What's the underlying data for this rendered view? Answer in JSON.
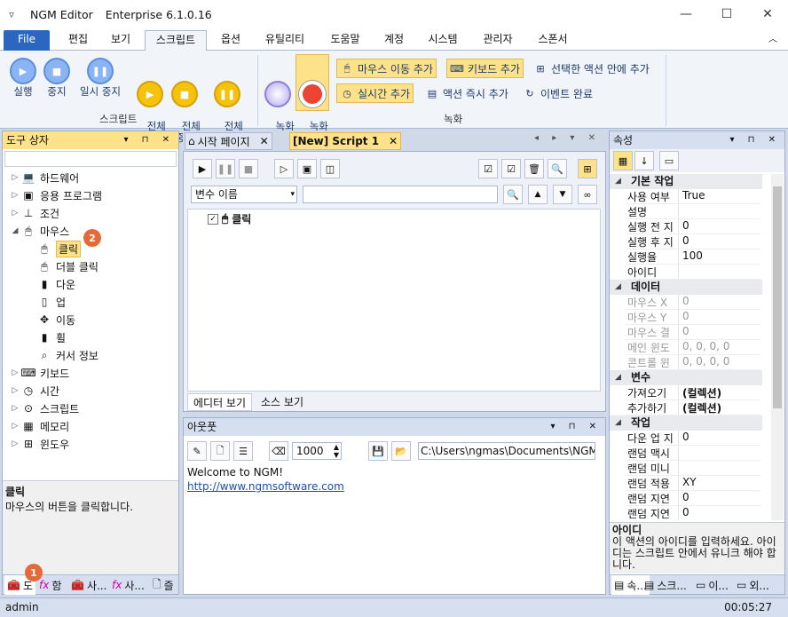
{
  "titlebar": {
    "quick_access": "▿",
    "app_name": "NGM Editor",
    "edition": "Enterprise 6.1.0.16"
  },
  "menu_tabs": [
    "File",
    "편집",
    "보기",
    "스크립트",
    "옵션",
    "유틸리티",
    "도움말",
    "계정",
    "시스템",
    "관리자",
    "스폰서"
  ],
  "ribbon": {
    "script_group": {
      "label": "스크립트",
      "buttons": [
        {
          "label": "실행",
          "icon": "play-icon"
        },
        {
          "label": "중지",
          "icon": "stop-icon"
        },
        {
          "label": "일시 중지",
          "icon": "pause-icon"
        },
        {
          "label": "전체\n실행",
          "icon": "play-all-icon"
        },
        {
          "label": "전체\n중지",
          "icon": "stop-all-icon"
        },
        {
          "label": "전체\n일시 중지",
          "icon": "pause-all-icon"
        }
      ]
    },
    "record_group": {
      "label": "녹화",
      "start": "녹화\n시작",
      "stop": "녹화\n중지",
      "mouse_move_add": "마우스 이동 추가",
      "keyboard_add": "키보드 추가",
      "in_selected": "선택한 액션 안에 추가",
      "realtime_add": "실시간 추가",
      "immediate_add": "액션 즉시 추가",
      "event_complete": "이벤트 완료"
    }
  },
  "toolbox": {
    "title": "도구 상자",
    "items": [
      {
        "label": "하드웨어",
        "icon": "laptop-icon",
        "level": 0,
        "exp": "▷"
      },
      {
        "label": "응용 프로그램",
        "icon": "app-window-icon",
        "level": 0,
        "exp": "▷"
      },
      {
        "label": "조건",
        "icon": "condition-icon",
        "level": 0,
        "exp": "▷"
      },
      {
        "label": "마우스",
        "icon": "mouse-icon",
        "level": 0,
        "exp": "◢"
      },
      {
        "label": "클릭",
        "icon": "mouse-click-icon",
        "level": 1,
        "exp": ""
      },
      {
        "label": "더블 클릭",
        "icon": "double-click-icon",
        "level": 1,
        "exp": ""
      },
      {
        "label": "다운",
        "icon": "mouse-down-icon",
        "level": 1,
        "exp": ""
      },
      {
        "label": "업",
        "icon": "mouse-up-icon",
        "level": 1,
        "exp": ""
      },
      {
        "label": "이동",
        "icon": "move-icon",
        "level": 1,
        "exp": ""
      },
      {
        "label": "휠",
        "icon": "wheel-icon",
        "level": 1,
        "exp": ""
      },
      {
        "label": "커서 정보",
        "icon": "cursor-info-icon",
        "level": 1,
        "exp": ""
      },
      {
        "label": "키보드",
        "icon": "keyboard-icon",
        "level": 0,
        "exp": "▷"
      },
      {
        "label": "시간",
        "icon": "clock-icon",
        "level": 0,
        "exp": "▷"
      },
      {
        "label": "스크립트",
        "icon": "script-icon",
        "level": 0,
        "exp": "▷"
      },
      {
        "label": "메모리",
        "icon": "memory-icon",
        "level": 0,
        "exp": "▷"
      },
      {
        "label": "윈도우",
        "icon": "windows-icon",
        "level": 0,
        "exp": "▷"
      }
    ],
    "desc_title": "클릭",
    "desc_text": "마우스의 버튼을 클릭합니다.",
    "bottom_tabs": [
      "도",
      "함",
      "사...",
      "사...",
      "즐"
    ]
  },
  "badges": {
    "one": "1",
    "two": "2"
  },
  "editor": {
    "tabs": [
      "시작 페이지",
      "[New] Script 1"
    ],
    "variable_select": "변수 이름",
    "search_value": "",
    "actions": [
      {
        "label": "클릭",
        "checked": true
      }
    ],
    "view_tabs": [
      "에디터 보기",
      "소스 보기"
    ]
  },
  "output": {
    "title": "아웃풋",
    "count": "1000",
    "path": "C:\\Users\\ngmas\\Documents\\NGM6\\",
    "lines": [
      "Welcome to NGM!",
      "http://www.ngmsoftware.com"
    ]
  },
  "properties": {
    "title": "속성",
    "sections": [
      {
        "name": "기본 작업",
        "rows": [
          {
            "k": "사용 여부",
            "v": "True",
            "dis": false
          },
          {
            "k": "설명",
            "v": "",
            "dis": false
          },
          {
            "k": "실행 전 지",
            "v": "0",
            "dis": false
          },
          {
            "k": "실행 후 지",
            "v": "0",
            "dis": false
          },
          {
            "k": "실행율",
            "v": "100",
            "dis": false
          },
          {
            "k": "아이디",
            "v": "",
            "dis": false
          }
        ]
      },
      {
        "name": "데이터",
        "rows": [
          {
            "k": "마우스 X",
            "v": "0",
            "dis": true
          },
          {
            "k": "마우스 Y",
            "v": "0",
            "dis": true
          },
          {
            "k": "마우스 결",
            "v": "0",
            "dis": true
          },
          {
            "k": "메인 윈도",
            "v": "0, 0, 0, 0",
            "dis": true
          },
          {
            "k": "콘트롤 윈",
            "v": "0, 0, 0, 0",
            "dis": true
          }
        ]
      },
      {
        "name": "변수",
        "rows": [
          {
            "k": "가져오기",
            "v": "(컬렉션)",
            "dis": false
          },
          {
            "k": "추가하기",
            "v": "(컬렉션)",
            "dis": false
          }
        ]
      },
      {
        "name": "작업",
        "rows": [
          {
            "k": "다운 업 지",
            "v": "0",
            "dis": false
          },
          {
            "k": "랜덤 맥시",
            "v": "",
            "dis": false
          },
          {
            "k": "랜덤 미니",
            "v": "",
            "dis": false
          },
          {
            "k": "랜덤 적용",
            "v": "XY",
            "dis": false
          },
          {
            "k": "랜덤 지연",
            "v": "0",
            "dis": false
          },
          {
            "k": "랜덤 지연",
            "v": "0",
            "dis": false
          }
        ]
      }
    ],
    "desc_title": "아이디",
    "desc_text": "이 액션의 아이디를 입력하세요. 아이디는 스크립트 안에서 유니크 해야 합니다.",
    "bottom_tabs": [
      "속...",
      "스크...",
      "이...",
      "외..."
    ]
  },
  "status": {
    "user": "admin",
    "time": "00:05:27"
  }
}
